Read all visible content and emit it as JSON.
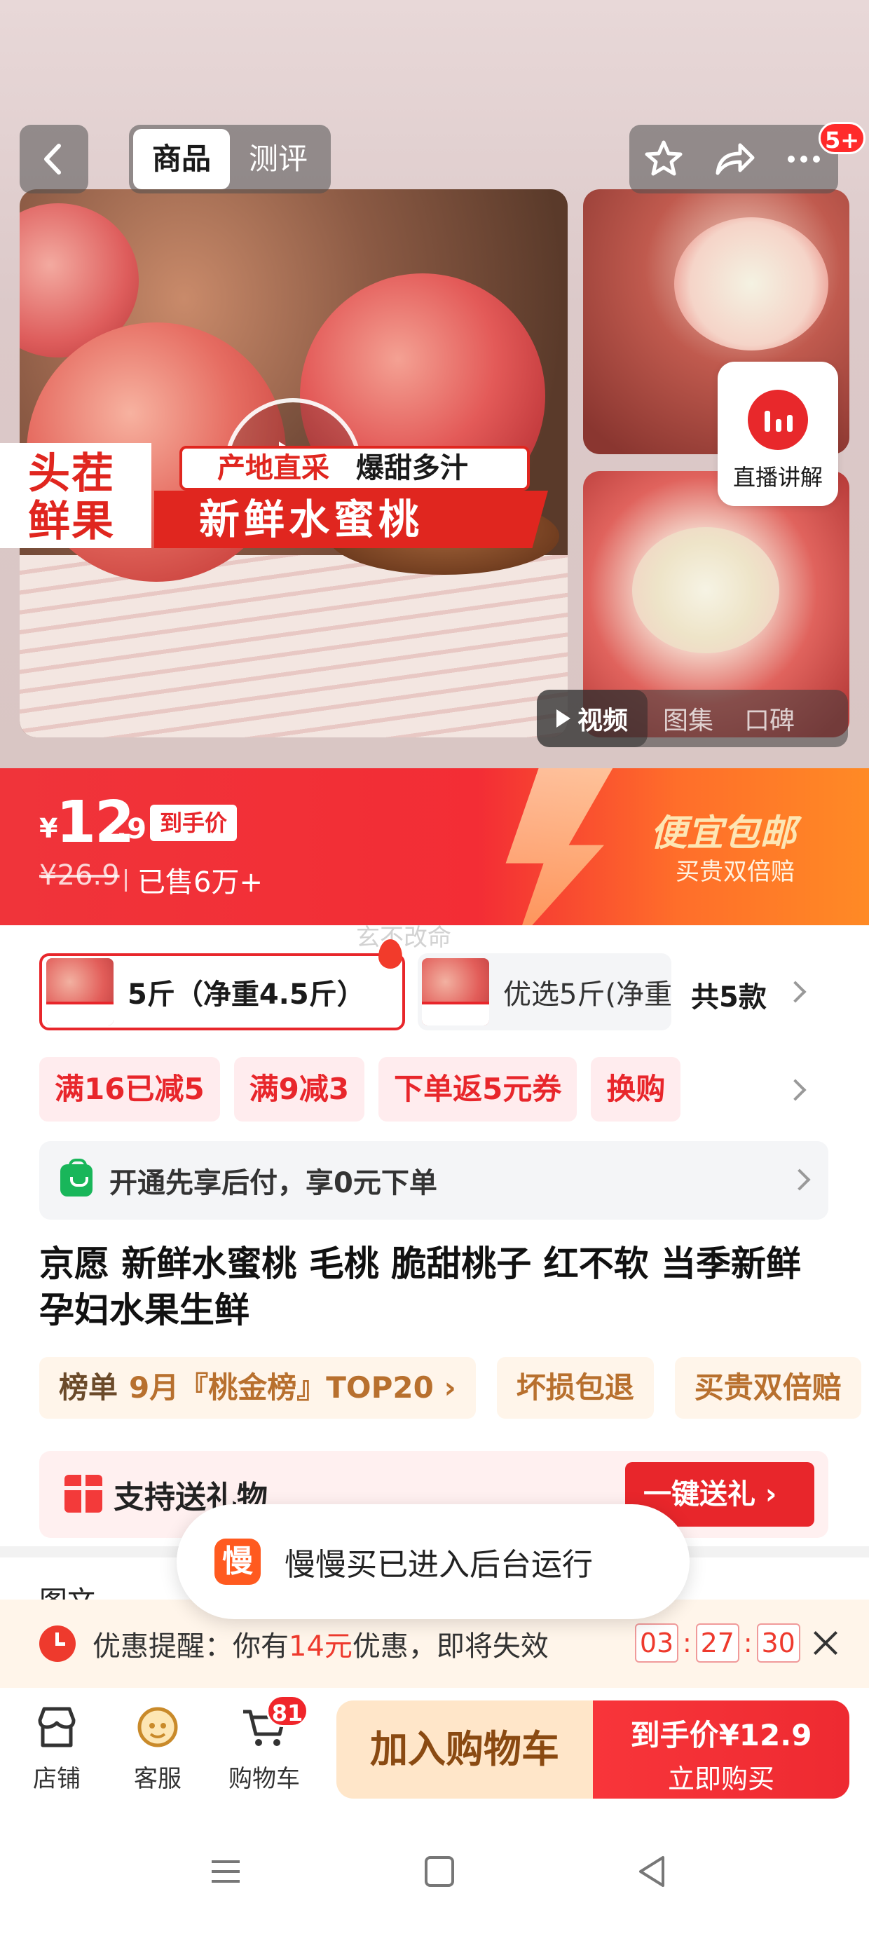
{
  "header": {
    "tabs": [
      {
        "label": "商品",
        "active": true
      },
      {
        "label": "测评",
        "active": false
      }
    ],
    "notification_badge": "5+"
  },
  "gallery": {
    "banner": {
      "left_line1": "头茬",
      "left_line2": "鲜果",
      "top_red": "产地直采",
      "top_black": "爆甜多汁",
      "main": "新鲜水蜜桃"
    },
    "live_label": "直播讲解",
    "media_tabs": [
      {
        "label": "视频",
        "active": true
      },
      {
        "label": "图集",
        "active": false
      },
      {
        "label": "口碑",
        "active": false
      }
    ]
  },
  "price": {
    "currency": "¥",
    "integer": "12",
    "decimal": ".9",
    "tag": "到手价",
    "original": "¥26.9",
    "sold": "已售6万+",
    "promo_title": "便宜包邮",
    "promo_sub": "买贵双倍赔"
  },
  "watermark": "玄不改命",
  "specs": {
    "options": [
      {
        "label": "5斤（净重4.5斤）",
        "selected": true
      },
      {
        "label": "优选5斤(净重",
        "selected": false
      }
    ],
    "count": "共5款"
  },
  "coupons": [
    "满16已减5",
    "满9减3",
    "下单返5元券",
    "换购"
  ],
  "paylater": "开通先享后付，享0元下单",
  "title": "京愿 新鲜水蜜桃 毛桃 脆甜桃子 红不软 当季新鲜孕妇水果生鲜",
  "tags": {
    "rank_label": "榜单",
    "rank_value": "9月『桃金榜』TOP20",
    "items": [
      "坏损包退",
      "买贵双倍赔"
    ]
  },
  "gift": {
    "label": "支持送礼物",
    "button": "一键送礼"
  },
  "next_section": "图文",
  "toast": {
    "logo_char": "慢",
    "text": "慢慢买已进入后台运行"
  },
  "reminder": {
    "prefix": "优惠提醒：你有",
    "amount": "14元",
    "suffix": "优惠，即将失效",
    "timer": [
      "03",
      "27",
      "30"
    ]
  },
  "bottom_bar": {
    "items": [
      "店铺",
      "客服",
      "购物车"
    ],
    "cart_count": "81",
    "add_cart": "加入购物车",
    "buy_line1": "到手价¥12.9",
    "buy_line2": "立即购买"
  },
  "colors": {
    "brand_red": "#e8262b",
    "price_gradient_end": "#ff8a25",
    "coupon_bg": "#ffecee",
    "tag_text": "#b8702e"
  }
}
